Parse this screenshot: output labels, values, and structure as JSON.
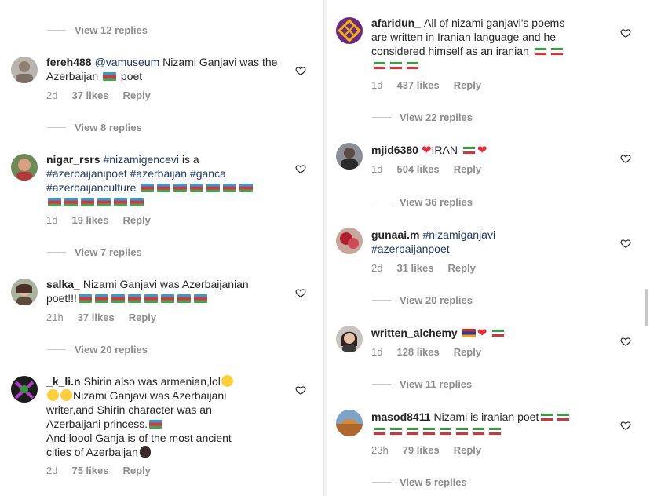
{
  "left": {
    "top_view_replies": "View 12 replies",
    "comments": [
      {
        "username": "fereh488",
        "text_parts": [
          "@vamuseum",
          " Nizami Ganjavi was the Azerbaijan ",
          " poet"
        ],
        "time": "2d",
        "likes": "37 likes",
        "reply": "Reply",
        "view_replies": "View 8 replies"
      },
      {
        "username": "nigar_rsrs",
        "tags": [
          "#nizamigencevi",
          "#azerbaijanipoet",
          "#azerbaijan",
          "#ganca",
          "#azerbaijanculture"
        ],
        "plain": " is a",
        "time": "1d",
        "likes": "19 likes",
        "reply": "Reply",
        "view_replies": "View 7 replies"
      },
      {
        "username": "salka_",
        "text_line1": "Nizami Ganjavi was Azerbaijanian",
        "text_line2": "poet!!!",
        "time": "21h",
        "likes": "37 likes",
        "reply": "Reply",
        "view_replies": "View 20 replies"
      },
      {
        "username": "_k_li.n",
        "text_line1": "Shirin also was armenian,lol",
        "text_line2": "Nizami Ganjavi was Azerbaijani",
        "text_line3": "writer,and Shirin character was an",
        "text_line4": "Azerbaijani princess.",
        "text_line5": "And loool Ganja is of the most ancient",
        "text_line6": "cities of Azerbaijan",
        "time": "2d",
        "likes": "75 likes",
        "reply": "Reply"
      }
    ]
  },
  "right": {
    "comments": [
      {
        "username": "afaridun_",
        "text_line1": "All of nizami ganjavi's poems",
        "text_line2": "are written in Iranian language and he",
        "text_line3": "considered himself as an iranian",
        "time": "1d",
        "likes": "437 likes",
        "reply": "Reply",
        "view_replies": "View 22 replies"
      },
      {
        "username": "mjid6380",
        "text": "IRAN",
        "time": "1d",
        "likes": "504 likes",
        "reply": "Reply",
        "view_replies": "View 36 replies"
      },
      {
        "username": "gunaai.m",
        "tag1": "#nizamiganjavi",
        "tag2": "#azerbaijanpoet",
        "time": "2d",
        "likes": "31 likes",
        "reply": "Reply",
        "view_replies": "View 20 replies"
      },
      {
        "username": "written_alchemy",
        "time": "1d",
        "likes": "128 likes",
        "reply": "Reply",
        "view_replies": "View 11 replies"
      },
      {
        "username": "masod8411",
        "text": "Nizami is iranian poet",
        "time": "23h",
        "likes": "79 likes",
        "reply": "Reply",
        "view_replies": "View 5 replies"
      }
    ]
  },
  "colors": {
    "hashtag": "#1e3a66",
    "meta": "#8e8e8e",
    "text": "#262626"
  },
  "icons": {
    "like": "heart-outline-icon"
  }
}
